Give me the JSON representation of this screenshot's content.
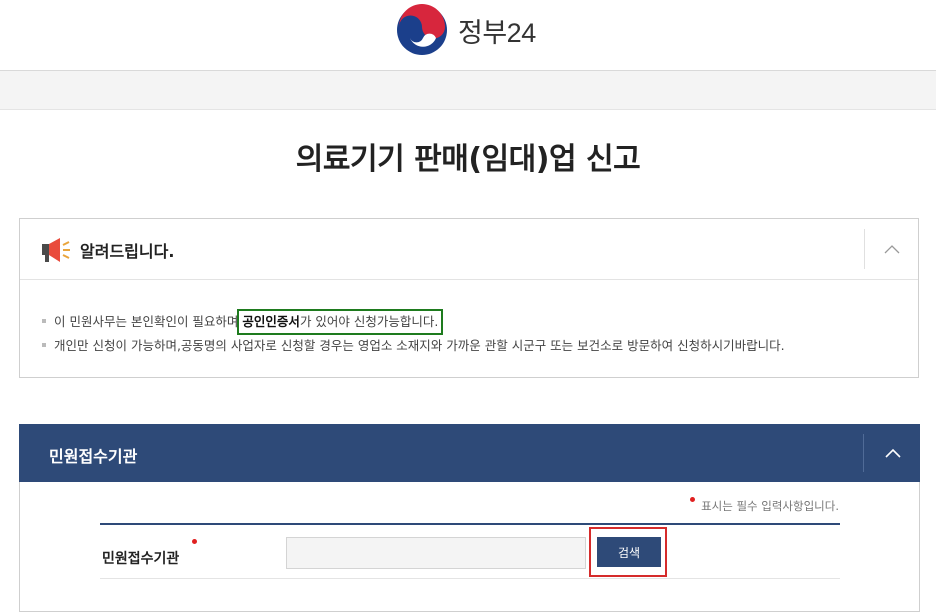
{
  "header": {
    "logo_text": "정부24",
    "logo_icon": "taegeuk-icon"
  },
  "page": {
    "title": "의료기기 판매(임대)업 신고"
  },
  "notice": {
    "title": "알려드립니다.",
    "icon": "megaphone-icon",
    "toggle_icon": "chevron-up-icon",
    "line1_pre": "이 민원사무는 본인확인이 필요하며",
    "line1_highlight": "공인인증서",
    "line1_post": "가 있어야 신청가능합니다.",
    "line2": "개인만 신청이 가능하며,공동명의 사업자로 신청할 경우는 영업소 소재지와 가까운 관할 시군구 또는 보건소로 방문하여 신청하시기바랍니다."
  },
  "section": {
    "title": "민원접수기관",
    "toggle_icon": "chevron-up-icon",
    "required_note": "표시는 필수 입력사항입니다.",
    "field_label": "민원접수기관",
    "field_value": "",
    "search_label": "검색"
  },
  "colors": {
    "navy": "#2e4a78",
    "required_red": "#e02020",
    "highlight_green": "#1e7b1e",
    "outline_red": "#d52b2b"
  }
}
